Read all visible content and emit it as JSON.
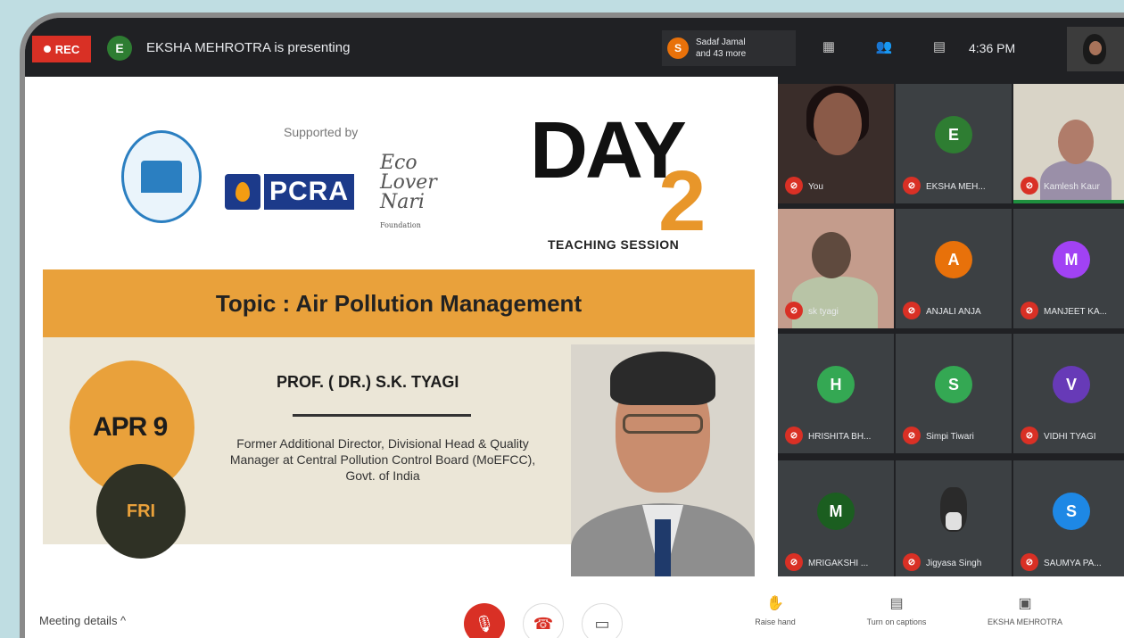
{
  "topbar": {
    "rec_label": "REC",
    "presenter_initial": "E",
    "presenting_text": "EKSHA MEHROTRA is presenting",
    "joiner_initial": "S",
    "joiner_text_line1": "Sadaf Jamal",
    "joiner_text_line2": "and 43 more",
    "time": "4:36 PM"
  },
  "slide": {
    "supported_by": "Supported by",
    "pcra": "PCRA",
    "eco_text": "Eco Lover Nari",
    "eco_small": "Foundation",
    "day_word": "DAY",
    "day_number": "2",
    "session_label": "TEACHING SESSION",
    "topic": "Topic : Air Pollution Management",
    "date": "APR 9",
    "weekday": "FRI",
    "speaker_name": "PROF. ( DR.) S.K. TYAGI",
    "speaker_desc": "Former Additional Director, Divisional Head & Quality Manager at Central Pollution Control Board (MoEFCC), Govt. of India"
  },
  "participants": [
    {
      "name": "You",
      "initial": "",
      "color": "",
      "video": "video1"
    },
    {
      "name": "EKSHA MEH...",
      "initial": "E",
      "color": "#2e7d32",
      "video": ""
    },
    {
      "name": "Kamlesh Kaur",
      "initial": "",
      "color": "",
      "video": "video2"
    },
    {
      "name": "sk tyagi",
      "initial": "",
      "color": "",
      "video": "video3"
    },
    {
      "name": "ANJALI ANJA",
      "initial": "A",
      "color": "#e8710a",
      "video": ""
    },
    {
      "name": "MANJEET KA...",
      "initial": "M",
      "color": "#a142f4",
      "video": ""
    },
    {
      "name": "HRISHITA BH...",
      "initial": "H",
      "color": "#34a853",
      "video": ""
    },
    {
      "name": "Simpi Tiwari",
      "initial": "S",
      "color": "#34a853",
      "video": ""
    },
    {
      "name": "VIDHI TYAGI",
      "initial": "V",
      "color": "#673ab7",
      "video": ""
    },
    {
      "name": "MRIGAKSHI ...",
      "initial": "M",
      "color": "#1b5e20",
      "video": ""
    },
    {
      "name": "Jigyasa Singh",
      "initial": "",
      "color": "",
      "video": "photo"
    },
    {
      "name": "SAUMYA PA...",
      "initial": "S",
      "color": "#1e88e5",
      "video": ""
    }
  ],
  "bottombar": {
    "meeting_details": "Meeting details ^",
    "raise_hand": "Raise hand",
    "turn_on_captions": "Turn on captions",
    "presenting_label": "EKSHA MEHROTRA"
  }
}
